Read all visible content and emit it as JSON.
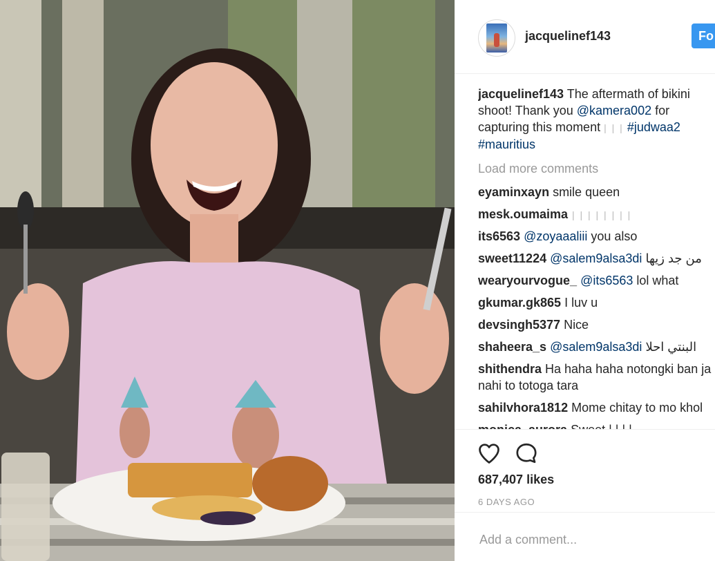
{
  "post": {
    "username": "jacquelinef143",
    "follow_label": "Fo",
    "caption": {
      "handle": "jacquelinef143",
      "text1": " The aftermath of bikini shoot! Thank you ",
      "mention": "@kamera002",
      "text2": " for capturing this moment ",
      "emoji": "| | |",
      "hashtag1": "#judwaa2",
      "hashtag2": "#mauritius"
    },
    "load_more": "Load more comments",
    "comments": [
      {
        "user": "eyaminxayn",
        "mention": "",
        "text": " smile queen"
      },
      {
        "user": "mesk.oumaima",
        "mention": "",
        "text": " | | | | | | | |"
      },
      {
        "user": "its6563",
        "mention": " @zoyaaaliii",
        "text": " you also"
      },
      {
        "user": "sweet11224",
        "mention": " @salem9alsa3di",
        "text": " من جد زيها"
      },
      {
        "user": "wearyourvogue_",
        "mention": " @its6563",
        "text": " lol what"
      },
      {
        "user": "gkumar.gk865",
        "mention": "",
        "text": " I luv u"
      },
      {
        "user": "devsingh5377",
        "mention": "",
        "text": " Nice"
      },
      {
        "user": "shaheera_s",
        "mention": " @salem9alsa3di",
        "text": " البنتي احلا"
      },
      {
        "user": "shithendra",
        "mention": "",
        "text": " Ha haha haha notongki ban ja nahi to totoga tara"
      },
      {
        "user": "sahilvhora1812",
        "mention": "",
        "text": " Mome chitay to mo khol"
      },
      {
        "user": "monica_aurora",
        "mention": "",
        "text": " Sweet | | | |"
      }
    ],
    "likes": "687,407 likes",
    "timestamp": "6 DAYS AGO",
    "add_comment_placeholder": "Add a comment..."
  },
  "icons": {
    "like": "heart-icon",
    "comment": "comment-bubble-icon"
  },
  "colors": {
    "follow_button": "#3897f0",
    "mention_link": "#003569",
    "muted": "#999999"
  }
}
